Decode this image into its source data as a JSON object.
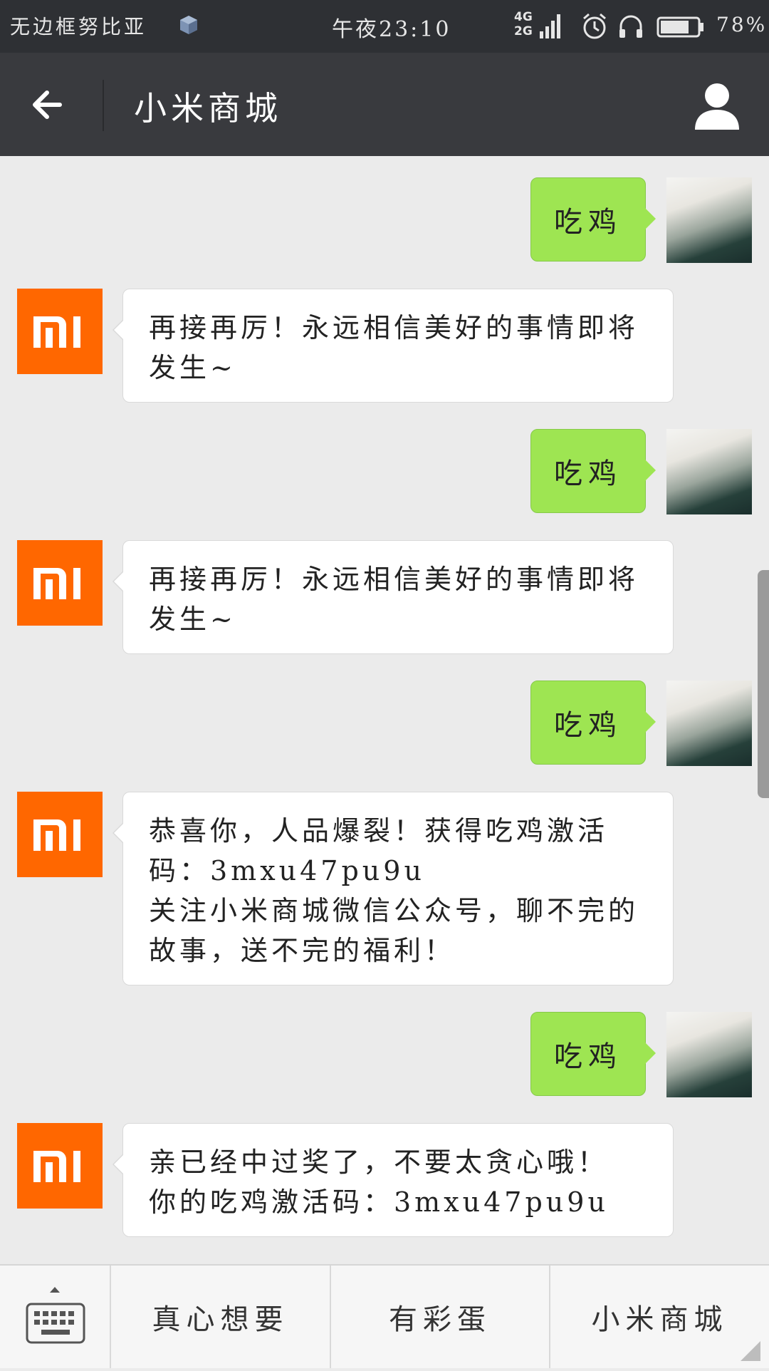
{
  "status_bar": {
    "carrier": "无边框努比亚",
    "time": "午夜23:10",
    "network_4g": "4G",
    "network_2g": "2G",
    "battery_percent": "78%",
    "battery_level": 0.78,
    "icons": [
      "cube-icon",
      "signal-icon",
      "alarm-icon",
      "headset-icon",
      "battery-icon"
    ]
  },
  "header": {
    "title": "小米商城",
    "back_icon": "back-arrow-icon",
    "profile_icon": "person-icon",
    "bg_color": "#393a3e"
  },
  "chat": {
    "messages": [
      {
        "from": "user",
        "text": "吃鸡"
      },
      {
        "from": "official",
        "text": "再接再厉！永远相信美好的事情即将发生~"
      },
      {
        "from": "user",
        "text": "吃鸡"
      },
      {
        "from": "official",
        "text": "再接再厉！永远相信美好的事情即将发生~"
      },
      {
        "from": "user",
        "text": "吃鸡"
      },
      {
        "from": "official",
        "text": "恭喜你，人品爆裂！获得吃鸡激活码：3mxu47pu9u\n关注小米商城微信公众号，聊不完的故事，送不完的福利！"
      },
      {
        "from": "user",
        "text": "吃鸡"
      },
      {
        "from": "official",
        "text": "亲已经中过奖了，不要太贪心哦！\n你的吃鸡激活码：3mxu47pu9u"
      }
    ],
    "official_avatar_text": "mi",
    "official_brand_color": "#ff6700",
    "user_bubble_color": "#9ee552"
  },
  "bottom_menu": {
    "keyboard_icon": "keyboard-icon",
    "items": [
      "真心想要",
      "有彩蛋",
      "小米商城"
    ]
  }
}
